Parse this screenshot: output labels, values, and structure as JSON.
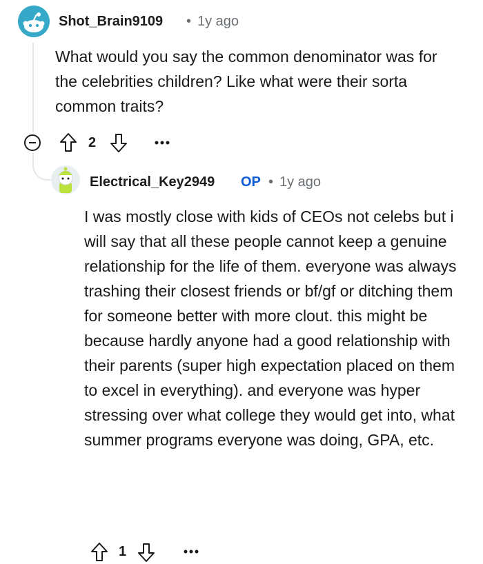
{
  "comment1": {
    "username": "Shot_Brain9109",
    "separator": "•",
    "time": "1y ago",
    "text": "What would you say the common denominator was for the celebrities children? Like what were their sorta common traits?",
    "votes": "2",
    "avatar_color": "#35a9c7"
  },
  "comment2": {
    "username": "Electrical_Key2949",
    "op_badge": "OP",
    "separator": "•",
    "time": "1y ago",
    "text": "I was mostly close with kids of CEOs not celebs but i will say that all these people cannot keep a genuine relationship for the life of them. everyone was always trashing their closest friends or bf/gf or ditching them for someone better with more clout. this might be because hardly anyone had a good relationship with their parents (super high expectation placed on them to excel in everything). and everyone was hyper stressing over what college they would get into, what summer programs everyone was doing, GPA, etc.",
    "votes": "1",
    "avatar_color": "#b9e23d"
  },
  "icons": {
    "collapse": "minus-circle-icon",
    "upvote": "arrow-up-icon",
    "downvote": "arrow-down-icon",
    "more": "ellipsis-icon"
  }
}
